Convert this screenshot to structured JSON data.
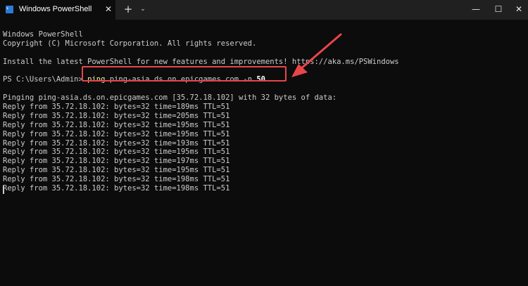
{
  "window": {
    "tab_title": "Windows PowerShell",
    "close_tab_glyph": "✕",
    "new_tab_glyph": "+",
    "dropdown_glyph": "⌄",
    "minimize_glyph": "—",
    "maximize_glyph": "☐",
    "close_glyph": "✕"
  },
  "console": {
    "header_line1": "Windows PowerShell",
    "header_line2": "Copyright (C) Microsoft Corporation. All rights reserved.",
    "install_line": "Install the latest PowerShell for new features and improvements! https://aka.ms/PSWindows",
    "prompt": "PS C:\\Users\\Admin> ",
    "command_name": "ping",
    "command_args": " ping-asia.ds.on.epicgames.com ",
    "command_flag": "-n",
    "command_count": "50",
    "pinging_line": "Pinging ping-asia.ds.on.epicgames.com [35.72.18.102] with 32 bytes of data:",
    "replies": [
      "Reply from 35.72.18.102: bytes=32 time=189ms TTL=51",
      "Reply from 35.72.18.102: bytes=32 time=205ms TTL=51",
      "Reply from 35.72.18.102: bytes=32 time=195ms TTL=51",
      "Reply from 35.72.18.102: bytes=32 time=195ms TTL=51",
      "Reply from 35.72.18.102: bytes=32 time=193ms TTL=51",
      "Reply from 35.72.18.102: bytes=32 time=195ms TTL=51",
      "Reply from 35.72.18.102: bytes=32 time=197ms TTL=51",
      "Reply from 35.72.18.102: bytes=32 time=195ms TTL=51",
      "Reply from 35.72.18.102: bytes=32 time=198ms TTL=51",
      "Reply from 35.72.18.102: bytes=32 time=198ms TTL=51"
    ]
  },
  "colors": {
    "background": "#0c0c0c",
    "titlebar": "#202020",
    "text": "#cccccc",
    "command": "#f9f1a5",
    "annotation": "#e8454a"
  },
  "icons": {
    "tab": "powershell-icon",
    "annotation": "red-arrow-annotation"
  }
}
